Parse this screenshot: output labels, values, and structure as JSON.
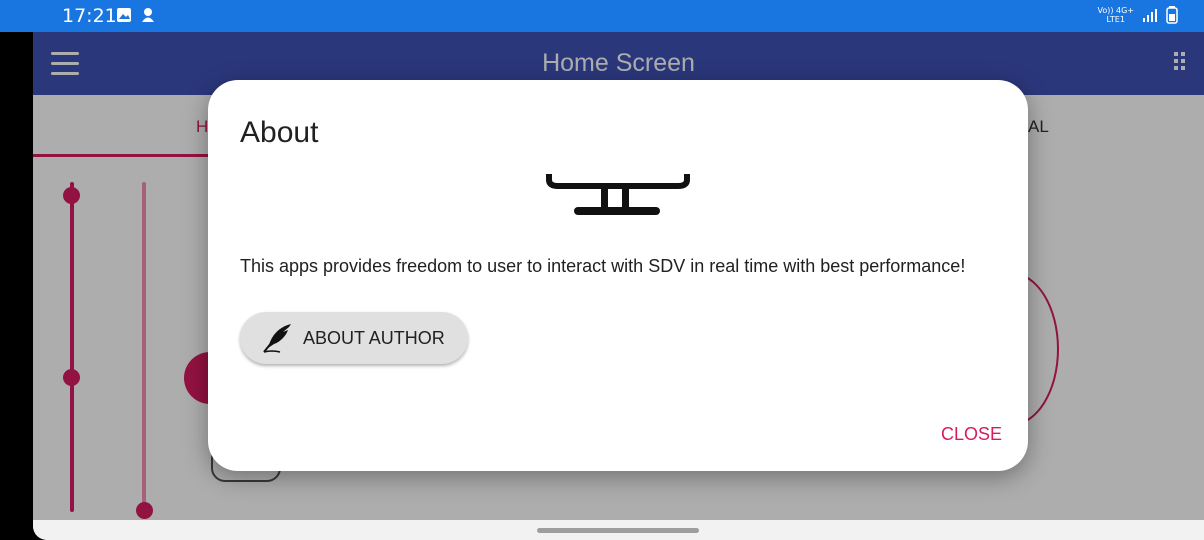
{
  "status_bar": {
    "time": "17:21",
    "network_top": "Vo)) 4G+",
    "network_bottom": "LTE1",
    "icons": [
      "image-icon",
      "app-notification-icon",
      "signal-icon",
      "battery-icon"
    ]
  },
  "app_bar": {
    "title": "Home Screen",
    "menu_icon": "hamburger-icon",
    "more_icon": "grip-icon"
  },
  "tabs": {
    "left_visible": "H",
    "right_visible": "AL"
  },
  "dialog": {
    "title": "About",
    "logo_icon": "sdv-logo-icon",
    "message": "This apps provides freedom to user to interact with SDV in real time with best performance!",
    "author_button_label": "ABOUT AUTHOR",
    "author_button_icon": "quill-icon",
    "close_label": "CLOSE"
  },
  "colors": {
    "status_bar": "#1976e0",
    "app_bar": "#3f51b5",
    "accent": "#d81b60",
    "button_bg": "#e0e0e0"
  }
}
